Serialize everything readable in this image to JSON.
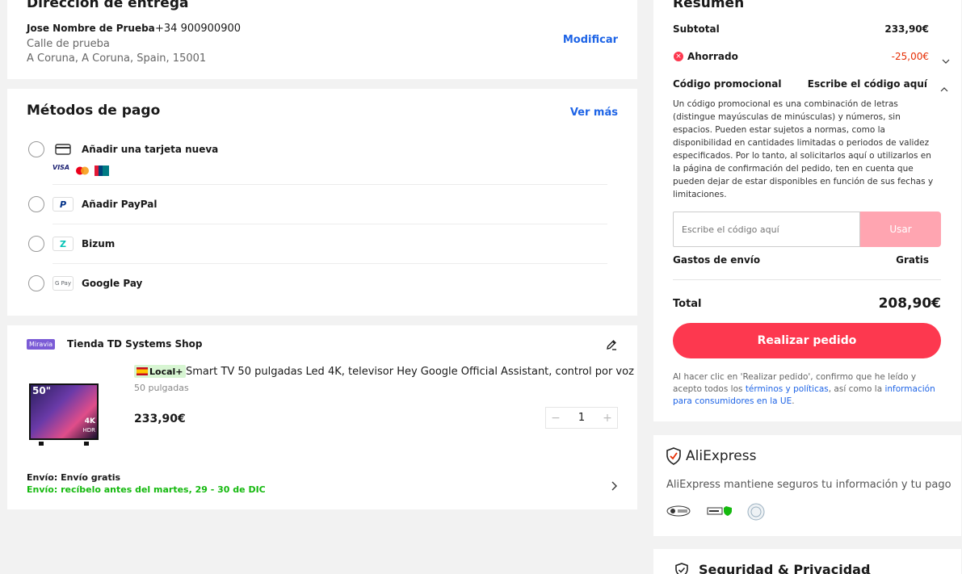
{
  "delivery": {
    "title": "Dirección de entrega",
    "name": "Jose Nombre de Prueba",
    "phone": "+34 900900900",
    "street": "Calle de prueba",
    "city": "A Coruna, A Coruna, Spain, 15001",
    "modify_label": "Modificar"
  },
  "payment": {
    "title": "Métodos de pago",
    "see_more": "Ver más",
    "methods": [
      {
        "label": "Añadir una tarjeta nueva",
        "icon": "credit-card-icon"
      },
      {
        "label": "Añadir PayPal",
        "icon": "paypal-icon"
      },
      {
        "label": "Bizum",
        "icon": "bizum-icon"
      },
      {
        "label": "Google Pay",
        "icon": "google-pay-icon"
      }
    ],
    "card_brands": [
      "VISA",
      "mastercard",
      "UnionPay"
    ],
    "gpay_text": "G Pay"
  },
  "store": {
    "badge": "Miravia",
    "name": "Tienda TD Systems Shop",
    "product": {
      "local_badge": "Local+",
      "title": "Smart TV 50 pulgadas Led 4K, televisor Hey Google Official Assistant, control por voz",
      "variant": "50 pulgadas",
      "price": "233,90€",
      "quantity": "1",
      "image_text": "50\"",
      "image_badge": "4K",
      "image_badge2": "HDR"
    },
    "shipping_label": "Envío: Envío gratis",
    "delivery_estimate": "Envío: recíbelo antes del martes, 29 - 30 de DIC"
  },
  "summary": {
    "title": "Resumen",
    "subtotal_label": "Subtotal",
    "subtotal_value": "233,90€",
    "saved_label": "Ahorrado",
    "saved_value": "-25,00€",
    "promo_label": "Código promocional",
    "promo_action": "Escribe el código aquí",
    "promo_description": "Un código promocional es una combinación de letras (distingue mayúsculas de minúsculas) y números, sin espacios. Pueden estar sujetos a normas, como la disponibilidad en cantidades limitadas o periodos de validez especificados. Por lo tanto, al solicitarlos aquí o utilizarlos en la página de confirmación del pedido, ten en cuenta que pueden dejar de estar disponibles en función de sus fechas y limitaciones.",
    "promo_placeholder": "Escribe el código aquí",
    "apply_label": "Usar",
    "shipping_label": "Gastos de envío",
    "shipping_value": "Gratis",
    "total_label": "Total",
    "total_value": "208,90€",
    "order_button": "Realizar pedido",
    "legal_prefix": "Al hacer clic en 'Realizar pedido', confirmo que he leído y acepto todos los ",
    "legal_link1": "términos y políticas",
    "legal_mid": ", así como la ",
    "legal_link2": "información para consumidores en la UE",
    "legal_suffix": "."
  },
  "trust": {
    "brand": "AliExpress",
    "text": "AliExpress mantiene seguros tu información y tu pago"
  },
  "security": {
    "title": "Seguridad & Privacidad"
  },
  "colors": {
    "accent_red": "#fd384f",
    "link_blue": "#1e64e6",
    "saved_red": "#e62e04",
    "green": "#15b90f"
  }
}
